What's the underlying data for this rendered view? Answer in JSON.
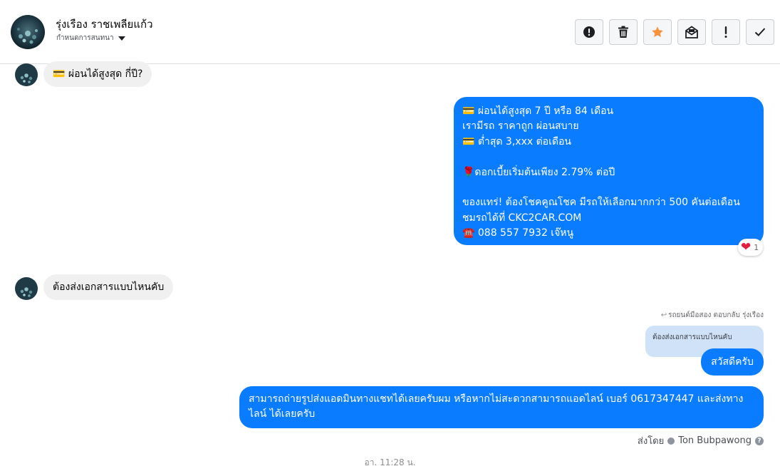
{
  "header": {
    "contact_name": "รุ่งเรือง ราชเพลียแก้ว",
    "assign_label": "กำหนดการสนทนา",
    "actions": [
      {
        "name": "mark-spam-button",
        "icon": "alert-circle-icon"
      },
      {
        "name": "delete-button",
        "icon": "trash-icon"
      },
      {
        "name": "star-button",
        "icon": "star-icon"
      },
      {
        "name": "mark-unread-button",
        "icon": "envelope-open-icon"
      },
      {
        "name": "follow-up-button",
        "icon": "exclamation-icon"
      },
      {
        "name": "mark-done-button",
        "icon": "check-icon"
      }
    ]
  },
  "messages": {
    "incoming_1": "💳 ผ่อนได้สูงสุด กี่ปี?",
    "outgoing_1": "💳 ผ่อนได้สูงสุด 7 ปี หรือ 84 เดือน\nเรามีรถ ราคาถูก ผ่อนสบาย\n💳 ต่ำสุด 3,xxx ต่อเดือน\n\n🌹ดอกเบี้ยเริ่มต้นเพียง 2.79% ต่อปี\n\nของแทร่! ต้องโชคคูณโชค มีรถให้เลือกมากกว่า 500 คันต่อเดือน\nชมรถได้ที่ CKC2CAR.COM\n☎️ 088 557 7932 เจ๊หนู",
    "outgoing_1_reaction": {
      "emoji": "❤",
      "count": "1"
    },
    "incoming_2": "ต้องส่งเอกสารแบบไหนคับ",
    "reply_note": "รถยนต์มือสอง ตอบกลับ รุ่งเรือง",
    "quoted_text": "ต้องส่งเอกสารแบบไหนคับ",
    "outgoing_2": "สวัสดีครับ",
    "outgoing_3": "สามารถถ่ายรูปส่งแอดมินทางแชทได้เลยครับผม หรือหากไม่สะดวกสามารถแอดไลน์ เบอร์ 0617347447 และส่งทางไลน์ ได้เลยครับ"
  },
  "sent_by": {
    "prefix": "ส่งโดย",
    "name": "Ton Bubpawong"
  },
  "timestamp": "อา. 11:28 น.",
  "colors": {
    "outgoing_bubble": "#0a7cff",
    "incoming_bubble": "#f0f0f0",
    "quoted_bubble": "#cfe2f8",
    "star": "#f7923b"
  }
}
